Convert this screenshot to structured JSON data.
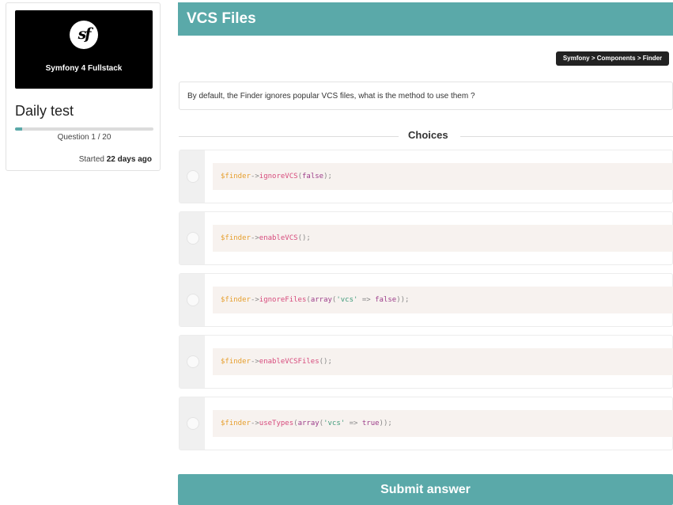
{
  "sidebar": {
    "logo_caption": "Symfony 4 Fullstack",
    "test_title": "Daily test",
    "progress": {
      "current": 1,
      "total": 20,
      "fraction": 0.05
    },
    "question_counter": "Question 1 / 20",
    "started_prefix": "Started",
    "started_value": "22 days ago"
  },
  "header": {
    "title": "VCS Files",
    "breadcrumb": "Symfony > Components > Finder"
  },
  "question": {
    "text": "By default, the Finder ignores popular VCS files, what is the method to use them ?"
  },
  "choices_heading": "Choices",
  "choices": [
    {
      "tokens": [
        {
          "t": "$finder",
          "c": "var"
        },
        {
          "t": "->",
          "c": "op"
        },
        {
          "t": "ignoreVCS",
          "c": "fn"
        },
        {
          "t": "(",
          "c": "op"
        },
        {
          "t": "false",
          "c": "kw"
        },
        {
          "t": ");",
          "c": "op"
        }
      ]
    },
    {
      "tokens": [
        {
          "t": "$finder",
          "c": "var"
        },
        {
          "t": "->",
          "c": "op"
        },
        {
          "t": "enableVCS",
          "c": "fn"
        },
        {
          "t": "();",
          "c": "op"
        }
      ]
    },
    {
      "tokens": [
        {
          "t": "$finder",
          "c": "var"
        },
        {
          "t": "->",
          "c": "op"
        },
        {
          "t": "ignoreFiles",
          "c": "fn"
        },
        {
          "t": "(",
          "c": "op"
        },
        {
          "t": "array",
          "c": "kw"
        },
        {
          "t": "(",
          "c": "op"
        },
        {
          "t": "'vcs'",
          "c": "str"
        },
        {
          "t": " => ",
          "c": "op"
        },
        {
          "t": "false",
          "c": "kw"
        },
        {
          "t": "));",
          "c": "op"
        }
      ]
    },
    {
      "tokens": [
        {
          "t": "$finder",
          "c": "var"
        },
        {
          "t": "->",
          "c": "op"
        },
        {
          "t": "enableVCSFiles",
          "c": "fn"
        },
        {
          "t": "();",
          "c": "op"
        }
      ]
    },
    {
      "tokens": [
        {
          "t": "$finder",
          "c": "var"
        },
        {
          "t": "->",
          "c": "op"
        },
        {
          "t": "useTypes",
          "c": "fn"
        },
        {
          "t": "(",
          "c": "op"
        },
        {
          "t": "array",
          "c": "kw"
        },
        {
          "t": "(",
          "c": "op"
        },
        {
          "t": "'vcs'",
          "c": "str"
        },
        {
          "t": " => ",
          "c": "op"
        },
        {
          "t": "true",
          "c": "kw"
        },
        {
          "t": "));",
          "c": "op"
        }
      ]
    }
  ],
  "submit_label": "Submit answer",
  "colors": {
    "accent": "#5aa9a9",
    "breadcrumb_bg": "#222222",
    "code_bg": "#f7f2ef"
  },
  "icons": {
    "logo": "symfony-logo-icon",
    "radio": "radio-icon"
  }
}
